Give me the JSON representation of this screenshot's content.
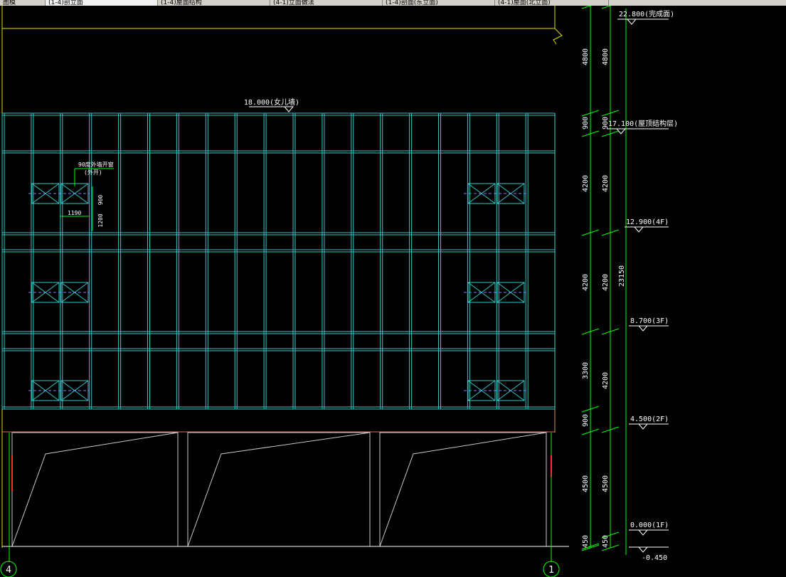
{
  "tabs": [
    {
      "label": "图模"
    },
    {
      "label": "(1-4)剖立面"
    },
    {
      "label": "(1-4)屋面结构"
    },
    {
      "label": "(4-1)立面做法"
    },
    {
      "label": "(1-4)剖面(东立面)"
    },
    {
      "label": "(4-1)屋面(北立面)"
    }
  ],
  "annotations": {
    "top_elevation": "18.000(女儿墙)",
    "note_line1": "90度外墙开窗",
    "note_line2": "(外开)",
    "note_dim_900": "900",
    "note_dim_1200": "1200",
    "note_dim_1190": "1190"
  },
  "dims_col1": [
    "4800",
    "900",
    "4200",
    "4200",
    "3300",
    "900",
    "4500",
    "450"
  ],
  "dims_col2": [
    "4800",
    "900",
    "4200",
    "4200",
    "4200",
    "4500",
    "450"
  ],
  "overall_dim": "23150",
  "levels": [
    {
      "label": "22.800(完成面)"
    },
    {
      "label": "17.100(屋顶结构层)"
    },
    {
      "label": "12.900(4F)"
    },
    {
      "label": "8.700(3F)"
    },
    {
      "label": "4.500(2F)"
    },
    {
      "label": "0.000(1F)"
    },
    {
      "label": "-0.450"
    }
  ],
  "axes": [
    {
      "label": "4"
    },
    {
      "label": "1"
    }
  ],
  "colors": {
    "background": "#000000",
    "curtain_wall": "#35c7c7",
    "level_line": "#ffffff",
    "dim_line": "#00ff00",
    "parapet_yellow": "#e0e000",
    "slab_orange": "#c89664",
    "red_line": "#ff3030"
  }
}
